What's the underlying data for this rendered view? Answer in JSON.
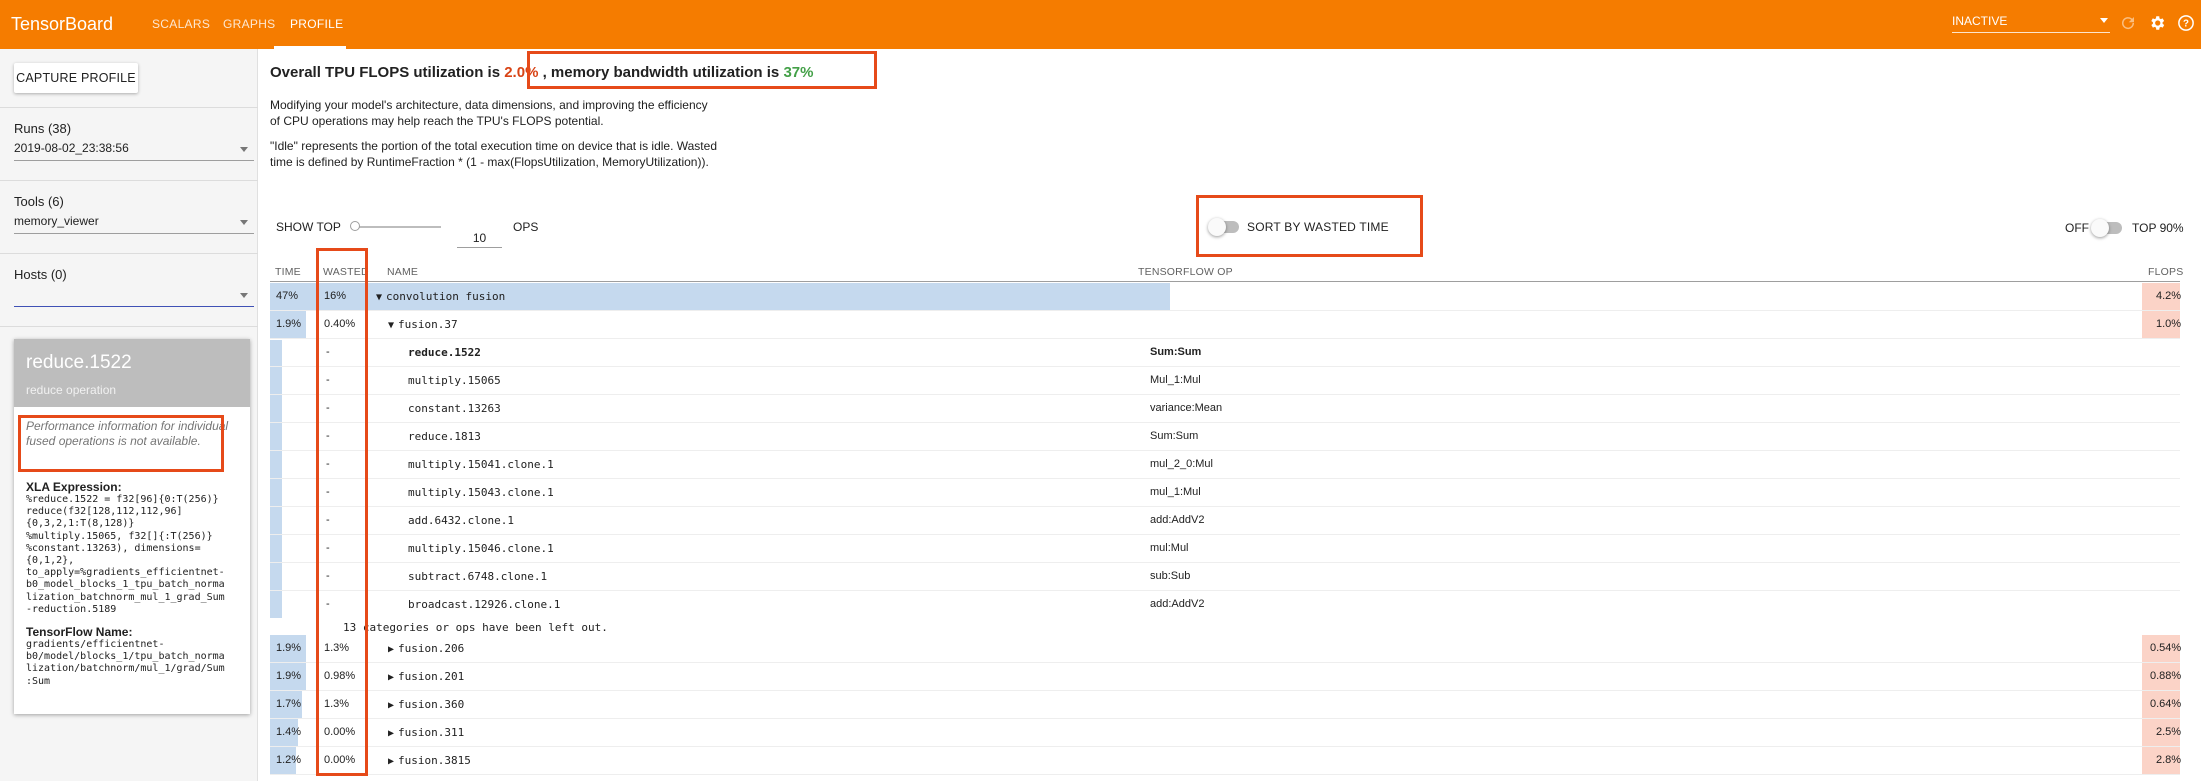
{
  "app": {
    "title": "TensorBoard",
    "nav_tabs": [
      "SCALARS",
      "GRAPHS",
      "PROFILE"
    ],
    "active_tab": "PROFILE",
    "status_select": "INACTIVE"
  },
  "sidebar": {
    "capture_button": "CAPTURE PROFILE",
    "runs_label": "Runs (38)",
    "runs_value": "2019-08-02_23:38:56",
    "tools_label": "Tools (6)",
    "tools_value": "memory_viewer",
    "hosts_label": "Hosts (0)",
    "hosts_value": ""
  },
  "detail_card": {
    "title": "reduce.1522",
    "subtitle": "reduce operation",
    "warning": "Performance information for individual fused operations is not available.",
    "xla_heading": "XLA Expression:",
    "xla_expression": "%reduce.1522 = f32[96]{0:T(256)}\nreduce(f32[128,112,112,96]\n{0,3,2,1:T(8,128)}\n%multiply.15065, f32[]{:T(256)}\n%constant.13263), dimensions=\n{0,1,2},\nto_apply=%gradients_efficientnet-\nb0_model_blocks_1_tpu_batch_norma\nlization_batchnorm_mul_1_grad_Sum\n-reduction.5189",
    "tf_heading": "TensorFlow Name:",
    "tf_name": "gradients/efficientnet-\nb0/model/blocks_1/tpu_batch_norma\nlization/batchnorm/mul_1/grad/Sum\n:Sum"
  },
  "summary": {
    "prefix": "Overall TPU FLOPS utilization is ",
    "flops_util": "2.0%",
    "middle": " , memory bandwidth utilization is ",
    "mem_util": "37%",
    "para1_line1": "Modifying your model's architecture, data dimensions, and improving the efficiency",
    "para1_line2": "of CPU operations may help reach the TPU's FLOPS potential.",
    "para2_line1": "\"Idle\" represents the portion of the total execution time on device that is idle. Wasted",
    "para2_line2": "time is defined by RuntimeFraction * (1 - max(FlopsUtilization, MemoryUtilization))."
  },
  "controls": {
    "show_top_label": "SHOW TOP",
    "show_top_value": "10",
    "ops_label": "OPS",
    "sort_label": "SORT BY WASTED TIME",
    "off_label": "OFF",
    "top90_label": "TOP 90%"
  },
  "table": {
    "headers": {
      "time": "TIME",
      "wasted": "WASTED",
      "name": "NAME",
      "tf_op": "TENSORFLOW OP",
      "flops": "FLOPS"
    },
    "top_rows": [
      {
        "time": "47%",
        "wasted": "16%",
        "name": "convolution fusion",
        "tf_op": "",
        "flops": "4.2%",
        "time_frac": 0.47,
        "flops_frac": 0.042
      },
      {
        "time": "1.9%",
        "wasted": "0.40%",
        "name": "fusion.37",
        "tf_op": "",
        "flops": "1.0%",
        "time_frac": 0.019,
        "flops_frac": 0.01
      }
    ],
    "child_rows": [
      {
        "wasted": "-",
        "name": "reduce.1522",
        "tf_op": "Sum:Sum"
      },
      {
        "wasted": "-",
        "name": "multiply.15065",
        "tf_op": "Mul_1:Mul"
      },
      {
        "wasted": "-",
        "name": "constant.13263",
        "tf_op": "variance:Mean"
      },
      {
        "wasted": "-",
        "name": "reduce.1813",
        "tf_op": "Sum:Sum"
      },
      {
        "wasted": "-",
        "name": "multiply.15041.clone.1",
        "tf_op": "mul_2_0:Mul"
      },
      {
        "wasted": "-",
        "name": "multiply.15043.clone.1",
        "tf_op": "mul_1:Mul"
      },
      {
        "wasted": "-",
        "name": "add.6432.clone.1",
        "tf_op": "add:AddV2"
      },
      {
        "wasted": "-",
        "name": "multiply.15046.clone.1",
        "tf_op": "mul:Mul"
      },
      {
        "wasted": "-",
        "name": "subtract.6748.clone.1",
        "tf_op": "sub:Sub"
      },
      {
        "wasted": "-",
        "name": "broadcast.12926.clone.1",
        "tf_op": "add:AddV2"
      }
    ],
    "left_out_note": "13 categories or ops have been left out.",
    "bottom_rows": [
      {
        "time": "1.9%",
        "wasted": "1.3%",
        "name": "fusion.206",
        "flops": "0.54%"
      },
      {
        "time": "1.9%",
        "wasted": "0.98%",
        "name": "fusion.201",
        "flops": "0.88%"
      },
      {
        "time": "1.7%",
        "wasted": "1.3%",
        "name": "fusion.360",
        "flops": "0.64%"
      },
      {
        "time": "1.4%",
        "wasted": "0.00%",
        "name": "fusion.311",
        "flops": "2.5%"
      },
      {
        "time": "1.2%",
        "wasted": "0.00%",
        "name": "fusion.3815",
        "flops": "2.8%"
      }
    ]
  },
  "colors": {
    "header": "#f57c00",
    "highlight": "#e64a19",
    "time_bar": "#c5d9ee",
    "flops_bar": "#fbd3c7"
  }
}
